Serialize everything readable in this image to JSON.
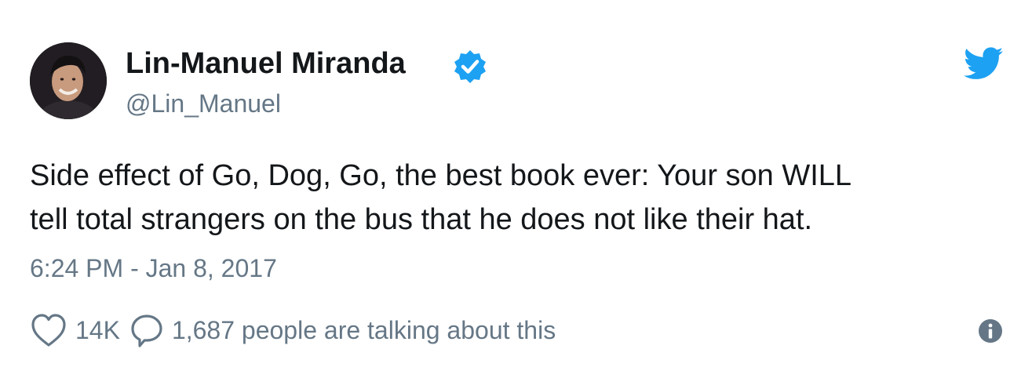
{
  "author": {
    "display_name": "Lin-Manuel Miranda",
    "handle": "@Lin_Manuel",
    "verified": true,
    "avatar_icon": "profile-photo"
  },
  "tweet": {
    "text_lines": [
      "Side effect of Go, Dog, Go, the best book ever: Your son WILL",
      "tell total strangers on the bus that he does not like their hat."
    ],
    "timestamp": "6:24 PM - Jan 8, 2017"
  },
  "actions": {
    "like_count": "14K",
    "talking": "1,687 people are talking about this"
  },
  "icons": {
    "twitter_logo": "twitter-bird-icon",
    "verified": "verified-badge-icon",
    "like": "heart-icon",
    "reply": "speech-bubble-icon",
    "info": "info-icon"
  },
  "colors": {
    "brand_blue": "#1da1f2",
    "text": "#14171a",
    "secondary_text": "#657786"
  }
}
